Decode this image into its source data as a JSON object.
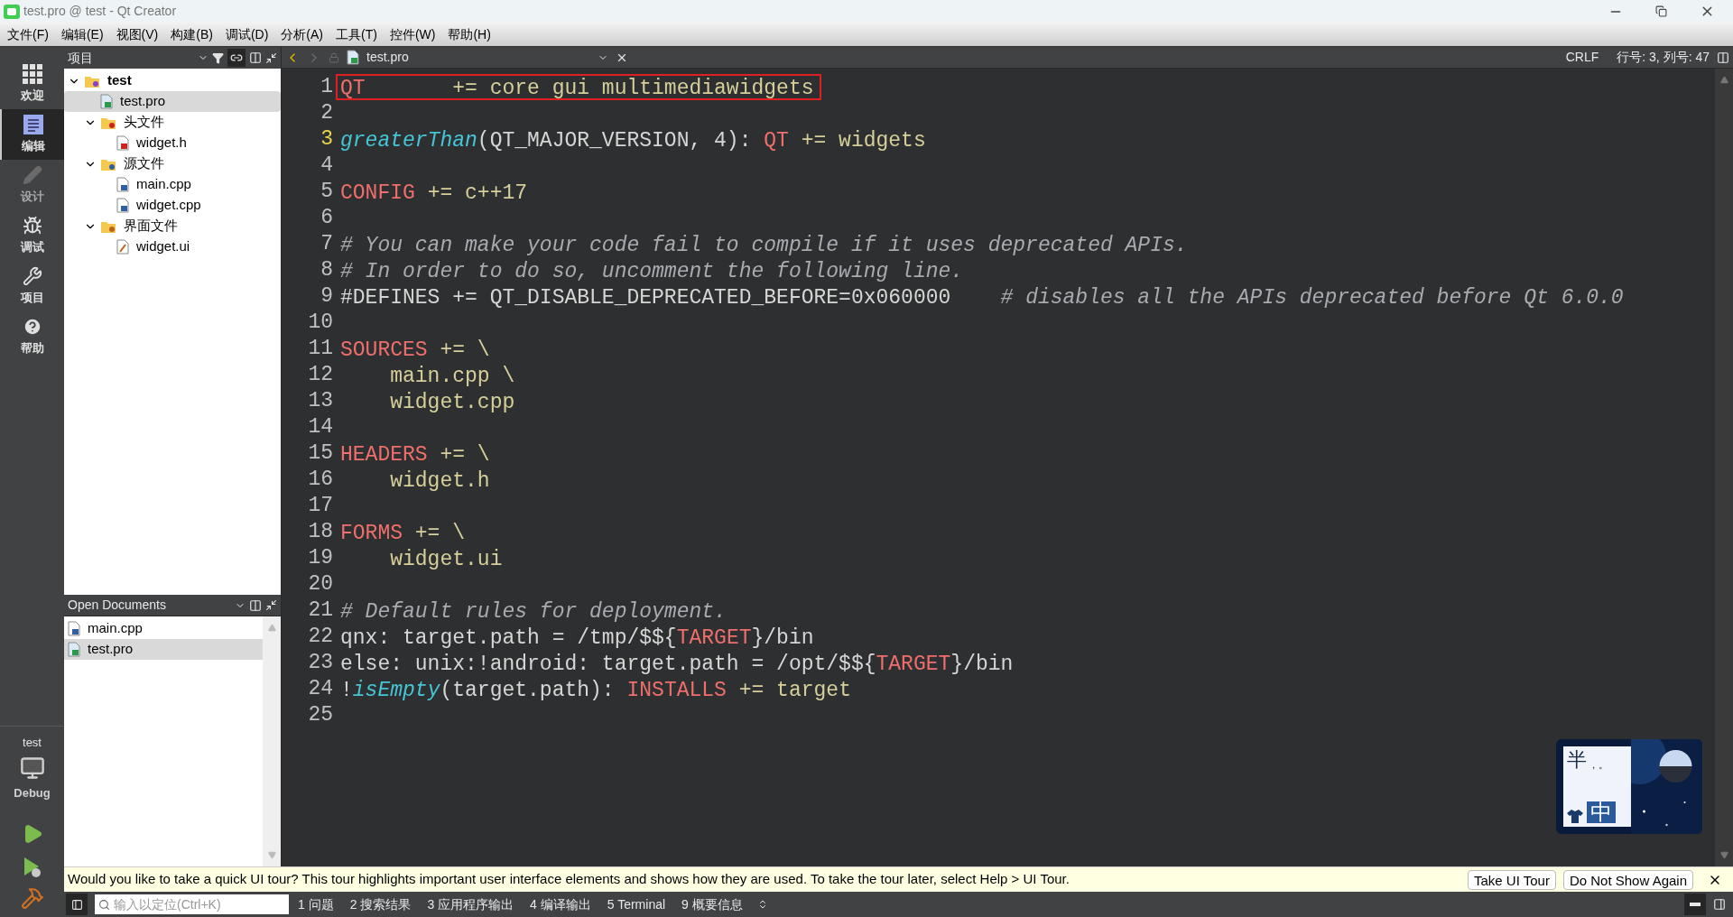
{
  "window": {
    "title": "test.pro @ test - Qt Creator"
  },
  "menu": [
    "文件(F)",
    "编辑(E)",
    "视图(V)",
    "构建(B)",
    "调试(D)",
    "分析(A)",
    "工具(T)",
    "控件(W)",
    "帮助(H)"
  ],
  "modes": [
    {
      "kind": "welcome",
      "label": "欢迎",
      "selected": false,
      "disabled": false
    },
    {
      "kind": "edit",
      "label": "编辑",
      "selected": true,
      "disabled": false
    },
    {
      "kind": "design",
      "label": "设计",
      "selected": false,
      "disabled": true
    },
    {
      "kind": "debug",
      "label": "调试",
      "selected": false,
      "disabled": false
    },
    {
      "kind": "projects",
      "label": "项目",
      "selected": false,
      "disabled": false
    },
    {
      "kind": "help",
      "label": "帮助",
      "selected": false,
      "disabled": false
    }
  ],
  "kit": {
    "project": "test",
    "build": "Debug"
  },
  "project_pane": {
    "title": "项目",
    "tree": [
      {
        "kind": "project",
        "label": "test",
        "expanded": true,
        "selected": false,
        "children": [
          {
            "kind": "pro",
            "label": "test.pro",
            "selected": false,
            "selected_row": true
          },
          {
            "kind": "folder-h",
            "label": "头文件",
            "expanded": true,
            "selected": false,
            "children": [
              {
                "kind": "header",
                "label": "widget.h",
                "selected": false
              }
            ]
          },
          {
            "kind": "folder-cpp",
            "label": "源文件",
            "expanded": true,
            "selected": false,
            "children": [
              {
                "kind": "cpp",
                "label": "main.cpp",
                "selected": false
              },
              {
                "kind": "cpp",
                "label": "widget.cpp",
                "selected": false
              }
            ]
          },
          {
            "kind": "folder-ui",
            "label": "界面文件",
            "expanded": true,
            "selected": false,
            "children": [
              {
                "kind": "ui",
                "label": "widget.ui",
                "selected": false
              }
            ]
          }
        ]
      }
    ]
  },
  "open_documents": {
    "title": "Open Documents",
    "items": [
      {
        "kind": "cpp",
        "label": "main.cpp",
        "selected": false
      },
      {
        "kind": "pro",
        "label": "test.pro",
        "selected": true
      }
    ]
  },
  "editor": {
    "file": "test.pro",
    "line_ending": "CRLF",
    "position": "行号: 3, 列号: 47",
    "lines": [
      {
        "number": "1",
        "current": false,
        "boxed": true,
        "tokens": [
          {
            "kind": "var",
            "text": "QT"
          },
          {
            "kind": "value",
            "text": "       += core gui multimediawidgets"
          }
        ]
      },
      {
        "number": "2",
        "current": false
      },
      {
        "number": "3",
        "current": true,
        "tokens": [
          {
            "kind": "func",
            "text": "greaterThan"
          },
          {
            "kind": "plain",
            "text": "(QT_MAJOR_VERSION, 4): "
          },
          {
            "kind": "var",
            "text": "QT"
          },
          {
            "kind": "value",
            "text": " += widgets"
          }
        ]
      },
      {
        "number": "4",
        "current": false
      },
      {
        "number": "5",
        "current": false,
        "tokens": [
          {
            "kind": "var",
            "text": "CONFIG"
          },
          {
            "kind": "value",
            "text": " += c++17"
          }
        ]
      },
      {
        "number": "6",
        "current": false
      },
      {
        "number": "7",
        "current": false,
        "tokens": [
          {
            "kind": "comment",
            "text": "# You can make your code fail to compile if it uses deprecated APIs."
          }
        ]
      },
      {
        "number": "8",
        "current": false,
        "tokens": [
          {
            "kind": "comment",
            "text": "# In order to do so, uncomment the following line."
          }
        ]
      },
      {
        "number": "9",
        "current": false,
        "tokens": [
          {
            "kind": "plain",
            "text": "#DEFINES += QT_DISABLE_DEPRECATED_BEFORE=0x060000    "
          },
          {
            "kind": "comment",
            "text": "# disables all the APIs deprecated before Qt 6.0.0"
          }
        ]
      },
      {
        "number": "10",
        "current": false
      },
      {
        "number": "11",
        "current": false,
        "tokens": [
          {
            "kind": "var",
            "text": "SOURCES"
          },
          {
            "kind": "value",
            "text": " += \\"
          }
        ]
      },
      {
        "number": "12",
        "current": false,
        "tokens": [
          {
            "kind": "value",
            "text": "    main.cpp \\"
          }
        ]
      },
      {
        "number": "13",
        "current": false,
        "tokens": [
          {
            "kind": "value",
            "text": "    widget.cpp"
          }
        ]
      },
      {
        "number": "14",
        "current": false
      },
      {
        "number": "15",
        "current": false,
        "tokens": [
          {
            "kind": "var",
            "text": "HEADERS"
          },
          {
            "kind": "value",
            "text": " += \\"
          }
        ]
      },
      {
        "number": "16",
        "current": false,
        "tokens": [
          {
            "kind": "value",
            "text": "    widget.h"
          }
        ]
      },
      {
        "number": "17",
        "current": false
      },
      {
        "number": "18",
        "current": false,
        "tokens": [
          {
            "kind": "var",
            "text": "FORMS"
          },
          {
            "kind": "value",
            "text": " += \\"
          }
        ]
      },
      {
        "number": "19",
        "current": false,
        "tokens": [
          {
            "kind": "value",
            "text": "    widget.ui"
          }
        ]
      },
      {
        "number": "20",
        "current": false
      },
      {
        "number": "21",
        "current": false,
        "tokens": [
          {
            "kind": "comment",
            "text": "# Default rules for deployment."
          }
        ]
      },
      {
        "number": "22",
        "current": false,
        "tokens": [
          {
            "kind": "plain",
            "text": "qnx: target.path = /tmp/$${"
          },
          {
            "kind": "var",
            "text": "TARGET"
          },
          {
            "kind": "plain",
            "text": "}/bin"
          }
        ]
      },
      {
        "number": "23",
        "current": false,
        "tokens": [
          {
            "kind": "plain",
            "text": "else: unix:!android: target.path = /opt/$${"
          },
          {
            "kind": "var",
            "text": "TARGET"
          },
          {
            "kind": "plain",
            "text": "}/bin"
          }
        ]
      },
      {
        "number": "24",
        "current": false,
        "tokens": [
          {
            "kind": "plain",
            "text": "!"
          },
          {
            "kind": "func",
            "text": "isEmpty"
          },
          {
            "kind": "plain",
            "text": "(target.path): "
          },
          {
            "kind": "var",
            "text": "INSTALLS"
          },
          {
            "kind": "value",
            "text": " += target"
          }
        ]
      },
      {
        "number": "25",
        "current": false
      }
    ]
  },
  "ime_widget": {
    "mode": "半",
    "punctuation": "，。",
    "language": "中"
  },
  "info_bar": {
    "text": "Would you like to take a quick UI tour? This tour highlights important user interface elements and shows how they are used. To take the tour later, select Help > UI Tour.",
    "buttons": [
      "Take UI Tour",
      "Do Not Show Again"
    ]
  },
  "status_bar": {
    "locator_placeholder": "输入以定位(Ctrl+K)",
    "panes": [
      "1 问题",
      "2 搜索结果",
      "3 应用程序输出",
      "4 编译输出",
      "5 Terminal",
      "9 概要信息"
    ]
  }
}
